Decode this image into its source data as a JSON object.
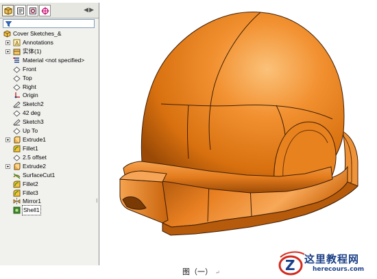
{
  "tree": {
    "root": "Cover Sketches_&",
    "items": [
      {
        "label": "Annotations",
        "icon": "annotations-icon",
        "expandable": true
      },
      {
        "label": "实体(1)",
        "icon": "solid-bodies-icon",
        "expandable": true
      },
      {
        "label": "Material <not specified>",
        "icon": "material-icon",
        "expandable": false
      },
      {
        "label": "Front",
        "icon": "plane-icon",
        "expandable": false
      },
      {
        "label": "Top",
        "icon": "plane-icon",
        "expandable": false
      },
      {
        "label": "Right",
        "icon": "plane-icon",
        "expandable": false
      },
      {
        "label": "Origin",
        "icon": "origin-icon",
        "expandable": false
      },
      {
        "label": "Sketch2",
        "icon": "sketch-icon",
        "expandable": false
      },
      {
        "label": "42 deg",
        "icon": "plane-icon",
        "expandable": false
      },
      {
        "label": "Sketch3",
        "icon": "sketch-icon",
        "expandable": false
      },
      {
        "label": "Up To",
        "icon": "plane-icon",
        "expandable": false
      },
      {
        "label": "Extrude1",
        "icon": "extrude-icon",
        "expandable": true
      },
      {
        "label": "Fillet1",
        "icon": "fillet-icon",
        "expandable": false
      },
      {
        "label": "2.5 offset",
        "icon": "plane-icon",
        "expandable": false
      },
      {
        "label": "Extrude2",
        "icon": "extrude-icon",
        "expandable": true
      },
      {
        "label": "SurfaceCut1",
        "icon": "surface-cut-icon",
        "expandable": false
      },
      {
        "label": "Fillet2",
        "icon": "fillet-icon",
        "expandable": false
      },
      {
        "label": "Fillet3",
        "icon": "fillet-icon",
        "expandable": false
      },
      {
        "label": "Mirror1",
        "icon": "mirror-icon",
        "expandable": false
      },
      {
        "label": "Shell1",
        "icon": "shell-icon",
        "expandable": false,
        "selected": true
      }
    ]
  },
  "tabs": [
    {
      "name": "feature-manager-tab",
      "active": true
    },
    {
      "name": "property-manager-tab",
      "active": false
    },
    {
      "name": "configuration-manager-tab",
      "active": false
    },
    {
      "name": "dimxpert-tab",
      "active": false
    }
  ],
  "tab_scroll": "◀▶",
  "caption": "图（一）",
  "caption_mark": "↵",
  "watermark": {
    "title": "这里教程网",
    "url": "herecours.com",
    "logo_letter": "Z"
  },
  "colors": {
    "model_base": "#e8821f",
    "model_highlight": "#f7b468",
    "model_shadow": "#8f4307",
    "edge": "#3d1d05",
    "panel_bg": "#f1f1ee",
    "watermark_blue": "#1b3f87",
    "watermark_red": "#d42a1e"
  }
}
